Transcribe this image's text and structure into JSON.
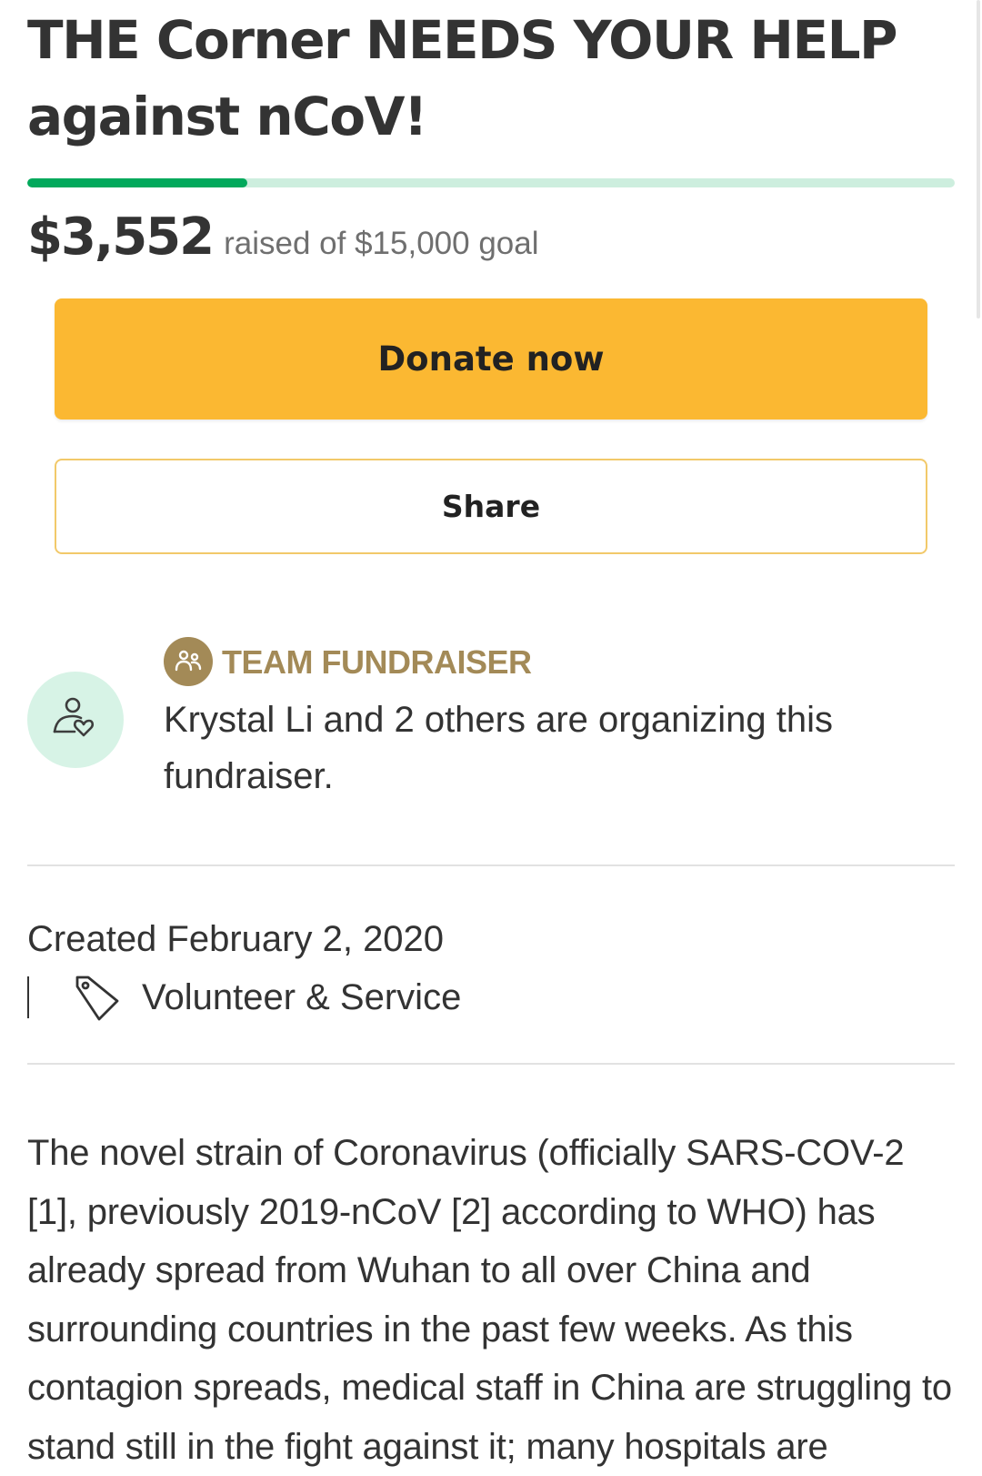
{
  "campaign": {
    "title": "THE Corner NEEDS YOUR HELP against nCoV!",
    "raised_amount": "$3,552",
    "raised_caption": "raised of $15,000 goal",
    "progress_fraction": 0.2368
  },
  "actions": {
    "donate_label": "Donate now",
    "share_label": "Share"
  },
  "organizer": {
    "badge_label": "TEAM FUNDRAISER",
    "badge_icon": "people-icon",
    "avatar_icon": "person-heart-icon",
    "description": "Krystal Li and 2 others are organizing this fundraiser."
  },
  "meta": {
    "created": "Created February 2, 2020",
    "category_icon": "tag-icon",
    "category": "Volunteer & Service"
  },
  "story": {
    "text": "The novel strain of Coronavirus (officially SARS-COV-2 [1], previously 2019-nCoV [2] according to WHO) has already spread from Wuhan to all over China and surrounding countries in the past few weeks. As this contagion spreads, medical staff in China are struggling to stand still in the fight against it; many hospitals are"
  },
  "colors": {
    "progress_fill": "#02a95c",
    "progress_track": "#cdeede",
    "donate_button": "#fbb832",
    "share_border": "#f2c96a",
    "team_accent": "#a38a57",
    "avatar_bg": "#d7f3e6",
    "text": "#333333"
  }
}
